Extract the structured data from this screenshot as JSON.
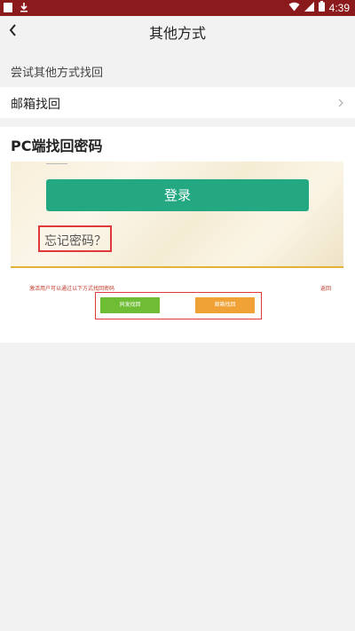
{
  "status_bar": {
    "time": "4:39",
    "icons": [
      "app-square-icon",
      "download-icon",
      "wifi-icon",
      "signal-icon",
      "battery-icon"
    ]
  },
  "header": {
    "title": "其他方式",
    "back_icon": "back-arrow-icon"
  },
  "section": {
    "label": "尝试其他方式找回"
  },
  "options": [
    {
      "label": "邮箱找回",
      "icon": "chevron-right-icon"
    }
  ],
  "pc_card": {
    "title": "PC端找回密码",
    "screenshot": {
      "login_button": "登录",
      "forgot_text": "忘记密码？",
      "hint_text": "激活用户可以通过以下方式找回密码",
      "back_link": "返回",
      "phone_button": "同发找回",
      "email_button": "邮箱找回"
    }
  },
  "colors": {
    "status_bar": "#8b1a1c",
    "login_green": "#23a882",
    "highlight_red": "#e0393b",
    "button_green": "#6fbd35",
    "button_orange": "#f0a236"
  }
}
